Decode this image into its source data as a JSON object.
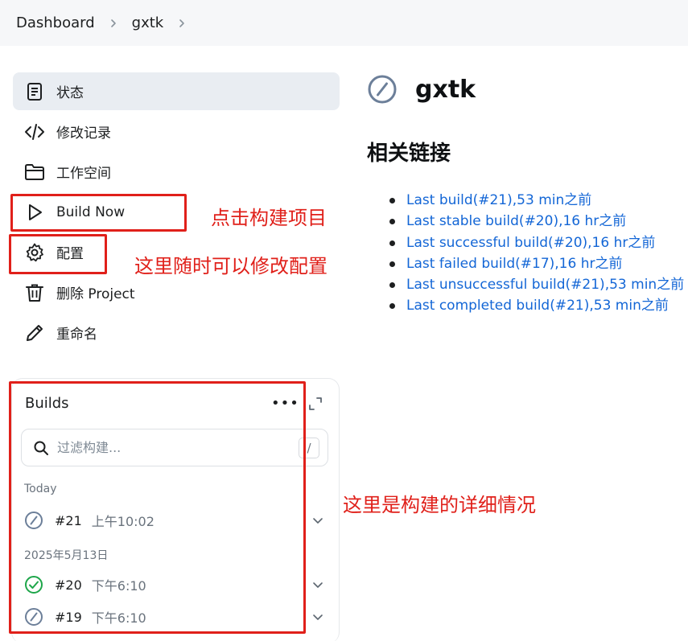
{
  "breadcrumb": {
    "items": [
      "Dashboard",
      "gxtk"
    ]
  },
  "nav": {
    "items": [
      {
        "label": "状态",
        "icon": "document-icon"
      },
      {
        "label": "修改记录",
        "icon": "code-icon"
      },
      {
        "label": "工作空间",
        "icon": "folder-icon"
      },
      {
        "label": "Build Now",
        "icon": "play-icon"
      },
      {
        "label": "配置",
        "icon": "gear-icon"
      },
      {
        "label": "删除 Project",
        "icon": "trash-icon"
      },
      {
        "label": "重命名",
        "icon": "pencil-icon"
      }
    ]
  },
  "project": {
    "name": "gxtk",
    "status_icon": "disabled-status-icon"
  },
  "related": {
    "heading": "相关链接",
    "links": [
      "Last build(#21),53 min之前",
      "Last stable build(#20),16 hr之前",
      "Last successful build(#20),16 hr之前",
      "Last failed build(#17),16 hr之前",
      "Last unsuccessful build(#21),53 min之前",
      "Last completed build(#21),53 min之前"
    ]
  },
  "builds": {
    "title": "Builds",
    "more": "•••",
    "search_placeholder": "过滤构建...",
    "search_shortcut": "/",
    "groups": [
      {
        "label": "Today"
      },
      {
        "label": "2025年5月13日"
      }
    ],
    "rows": [
      {
        "number": "#21",
        "time": "上午10:02",
        "status": "disabled"
      },
      {
        "number": "#20",
        "time": "下午6:10",
        "status": "success"
      },
      {
        "number": "#19",
        "time": "下午6:10",
        "status": "disabled"
      }
    ]
  },
  "annotations": {
    "build_now": "点击构建项目",
    "config": "这里随时可以修改配置",
    "builds": "这里是构建的详细情况"
  },
  "colors": {
    "link": "#1366d6",
    "annotation": "#e0201a",
    "success": "#1ea64a",
    "disabled": "#6c7f99"
  }
}
